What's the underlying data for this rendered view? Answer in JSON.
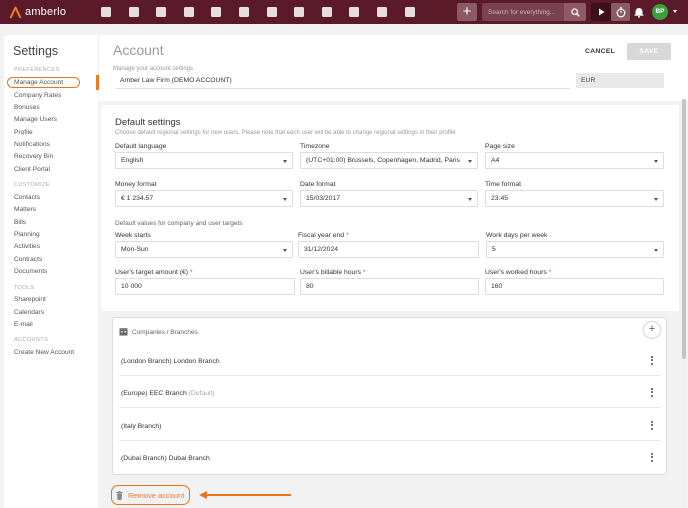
{
  "app": {
    "logo_text": "amberlo"
  },
  "topbar": {
    "nav_icons": [
      "apps-icon",
      "contacts-icon",
      "matters-icon",
      "bills-icon",
      "bank-icon",
      "calendar-icon",
      "time-icon",
      "expenses-icon",
      "folder-icon",
      "documents-icon",
      "mail-icon",
      "reports-icon"
    ],
    "add_label": "+",
    "search_placeholder": "Search for everything...",
    "avatar_initials": "BP"
  },
  "sidebar": {
    "title": "Settings",
    "sections": [
      {
        "label": "PREFERENCES",
        "items": [
          "Manage Account",
          "Company Rates",
          "Bonuses",
          "Manage Users",
          "Profile",
          "Notifications",
          "Recovery Bin",
          "Client Portal"
        ]
      },
      {
        "label": "CUSTOMIZE",
        "items": [
          "Contacts",
          "Matters",
          "Bills",
          "Planning",
          "Activities",
          "Contracts",
          "Documents"
        ]
      },
      {
        "label": "TOOLS",
        "items": [
          "Sharepoint",
          "Calendars",
          "E-mail"
        ]
      },
      {
        "label": "ACCOUNTS",
        "items": [
          "Create New Account"
        ]
      }
    ],
    "active_item": "Manage Account"
  },
  "header": {
    "title": "Account",
    "subtitle": "Manage your account settings",
    "cancel_label": "CANCEL",
    "save_label": "SAVE",
    "firm_name": "Amber Law Firm (DEMO ACCOUNT)",
    "currency": "EUR"
  },
  "defaults": {
    "title": "Default settings",
    "description": "Choose default regional settings for new users. Please note that each user will be able to change regional settings in their profile",
    "default_language": {
      "label": "Default language",
      "value": "English"
    },
    "timezone": {
      "label": "Timezone",
      "value": "(UTC+01:00) Brussels, Copenhagen, Madrid, Paris"
    },
    "page_size": {
      "label": "Page size",
      "value": "A4"
    },
    "money_format": {
      "label": "Money format",
      "value": "€ 1 234.57"
    },
    "date_format": {
      "label": "Date format",
      "value": "15/03/2017"
    },
    "time_format": {
      "label": "Time format",
      "value": "23:45"
    },
    "targets_description": "Default values for company and user targets",
    "week_starts": {
      "label": "Week starts",
      "value": "Mon-Sun"
    },
    "fiscal_year_end": {
      "label": "Fiscal year end",
      "value": "31/12/2024"
    },
    "work_days": {
      "label": "Work days per week",
      "value": "5"
    },
    "target_amount": {
      "label": "User's target amount (€)",
      "value": "10 000"
    },
    "billable_hours": {
      "label": "User's billable hours",
      "value": "80"
    },
    "worked_hours": {
      "label": "User's worked hours",
      "value": "160"
    },
    "required_mark": "*"
  },
  "branches": {
    "heading": "Companies / Branches",
    "add_label": "+",
    "items": [
      {
        "name": "(London Branch) London Branch",
        "tag": ""
      },
      {
        "name": "(Europe) EEC Branch",
        "tag": "(Default)"
      },
      {
        "name": "(Italy Branch)",
        "tag": ""
      },
      {
        "name": "(Dubai Branch) Dubai Branch",
        "tag": ""
      }
    ]
  },
  "remove_account_label": "Remove account",
  "colors": {
    "topbar": "#5b1a2a",
    "accent": "#e8731e",
    "avatar": "#3aa03a"
  }
}
